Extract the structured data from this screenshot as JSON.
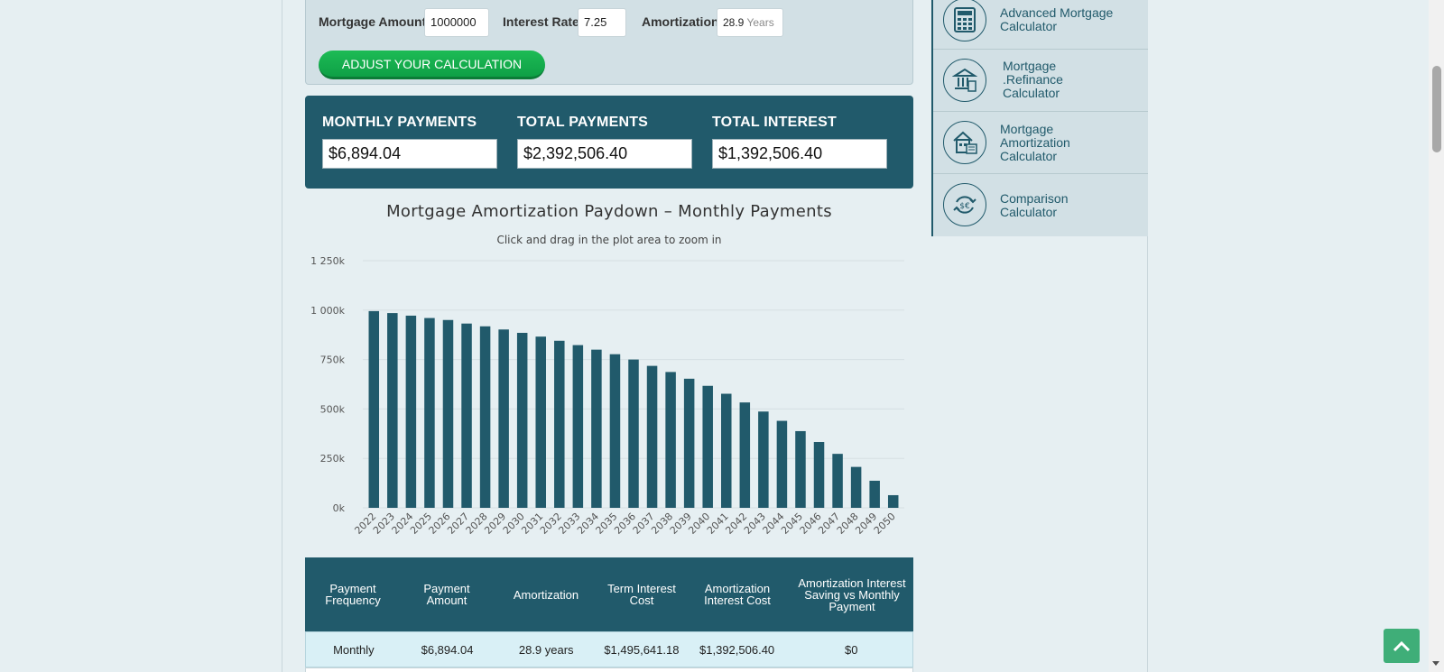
{
  "inputs": {
    "mortgage_amount_label": "Mortgage Amount",
    "mortgage_amount_value": "1000000",
    "interest_rate_label": "Interest Rate",
    "interest_rate_value": "7.25",
    "amortization_label": "Amortization",
    "amortization_value": "28.9",
    "amortization_unit": "Years",
    "adjust_button": "ADJUST YOUR CALCULATION"
  },
  "results": {
    "monthly_label": "MONTHLY PAYMENTS",
    "monthly_value": "$6,894.04",
    "total_label": "TOTAL PAYMENTS",
    "total_value": "$2,392,506.40",
    "interest_label": "TOTAL INTEREST",
    "interest_value": "$1,392,506.40"
  },
  "chart_data": {
    "type": "bar",
    "title": "Mortgage Amortization Paydown – Monthly Payments",
    "subtitle": "Click and drag in the plot area to zoom in",
    "xlabel": "",
    "ylabel": "",
    "ylim": [
      0,
      1250
    ],
    "y_ticks": [
      "0k",
      "250k",
      "500k",
      "750k",
      "1 000k",
      "1 250k"
    ],
    "categories": [
      "2022",
      "2023",
      "2024",
      "2025",
      "2026",
      "2027",
      "2028",
      "2029",
      "2030",
      "2031",
      "2032",
      "2033",
      "2034",
      "2035",
      "2036",
      "2037",
      "2038",
      "2039",
      "2040",
      "2041",
      "2042",
      "2043",
      "2044",
      "2045",
      "2046",
      "2047",
      "2048",
      "2049",
      "2050"
    ],
    "values": [
      995,
      985,
      972,
      960,
      950,
      932,
      918,
      902,
      885,
      866,
      845,
      823,
      800,
      777,
      750,
      718,
      687,
      653,
      617,
      577,
      533,
      487,
      440,
      388,
      333,
      273,
      207,
      137,
      64
    ],
    "bar_color": "#215a6b",
    "grid": true
  },
  "table": {
    "headers": [
      "Payment Frequency",
      "Payment Amount",
      "Amortization",
      "Term Interest Cost",
      "Amortization Interest Cost",
      "Amortization Interest Saving vs Monthly Payment"
    ],
    "rows": [
      [
        "Monthly",
        "$6,894.04",
        "28.9 years",
        "$1,495,641.18",
        "$1,392,506.40",
        "$0"
      ]
    ]
  },
  "sidebar": {
    "items": [
      {
        "label": "Advanced Mortgage\nCalculator",
        "icon": "calculator-icon"
      },
      {
        "label": "Mortgage\n.Refinance\nCalculator",
        "icon": "bank-icon"
      },
      {
        "label": "Mortgage\nAmortization\nCalculator",
        "icon": "house-icon"
      },
      {
        "label": "Comparison\nCalculator",
        "icon": "compare-icon"
      }
    ]
  },
  "colors": {
    "primary": "#215a6b",
    "accent_green": "#14ab4d",
    "panel": "#d2e0e5"
  }
}
